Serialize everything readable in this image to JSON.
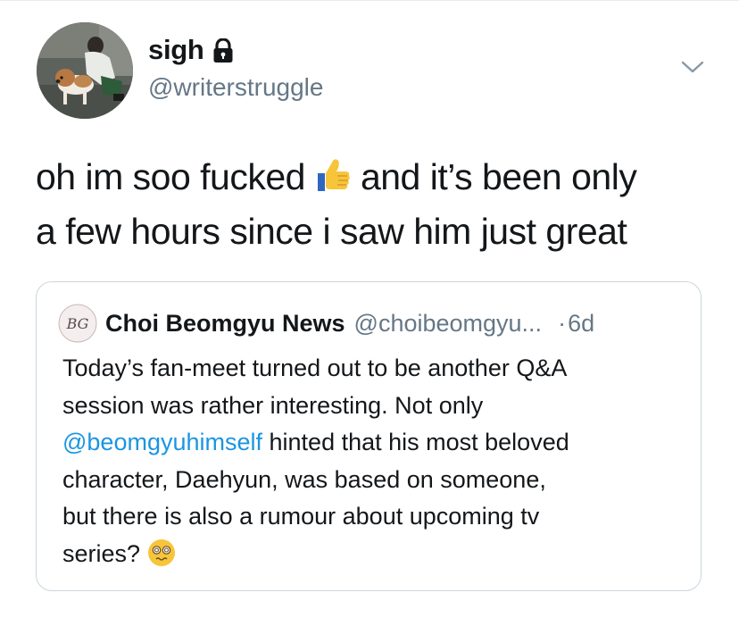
{
  "tweet": {
    "author": {
      "display_name": "sigh",
      "handle": "@writerstruggle",
      "protected_icon": "lock-icon",
      "avatar_icon": "avatar-photo"
    },
    "menu_icon": "chevron-down-icon",
    "text": {
      "line1_a": "oh im soo fucked",
      "emoji": "thumbs-up-emoji",
      "line1_b": "and it’s been only",
      "line2": "a few hours since i saw him just great"
    }
  },
  "quoted_tweet": {
    "avatar_text": "BG",
    "author_name": "Choi Beomgyu News",
    "handle": "@choibeomgyu...",
    "dot": "·",
    "time": "6d",
    "body": {
      "line1": "Today’s fan-meet turned out to be another Q&A",
      "line2": "session was rather interesting. Not only",
      "mention": "@beomgyuhimself",
      "line3_rest": " hinted that his most beloved",
      "line4": "character, Daehyun, was based on someone,",
      "line5": "but there is also a rumour about upcoming tv",
      "line6": "series?",
      "emoji": "dizzy-face-emoji"
    }
  },
  "colors": {
    "text": "#14171a",
    "secondary": "#657786",
    "link": "#1b95e0",
    "border": "#ccd6dd"
  }
}
